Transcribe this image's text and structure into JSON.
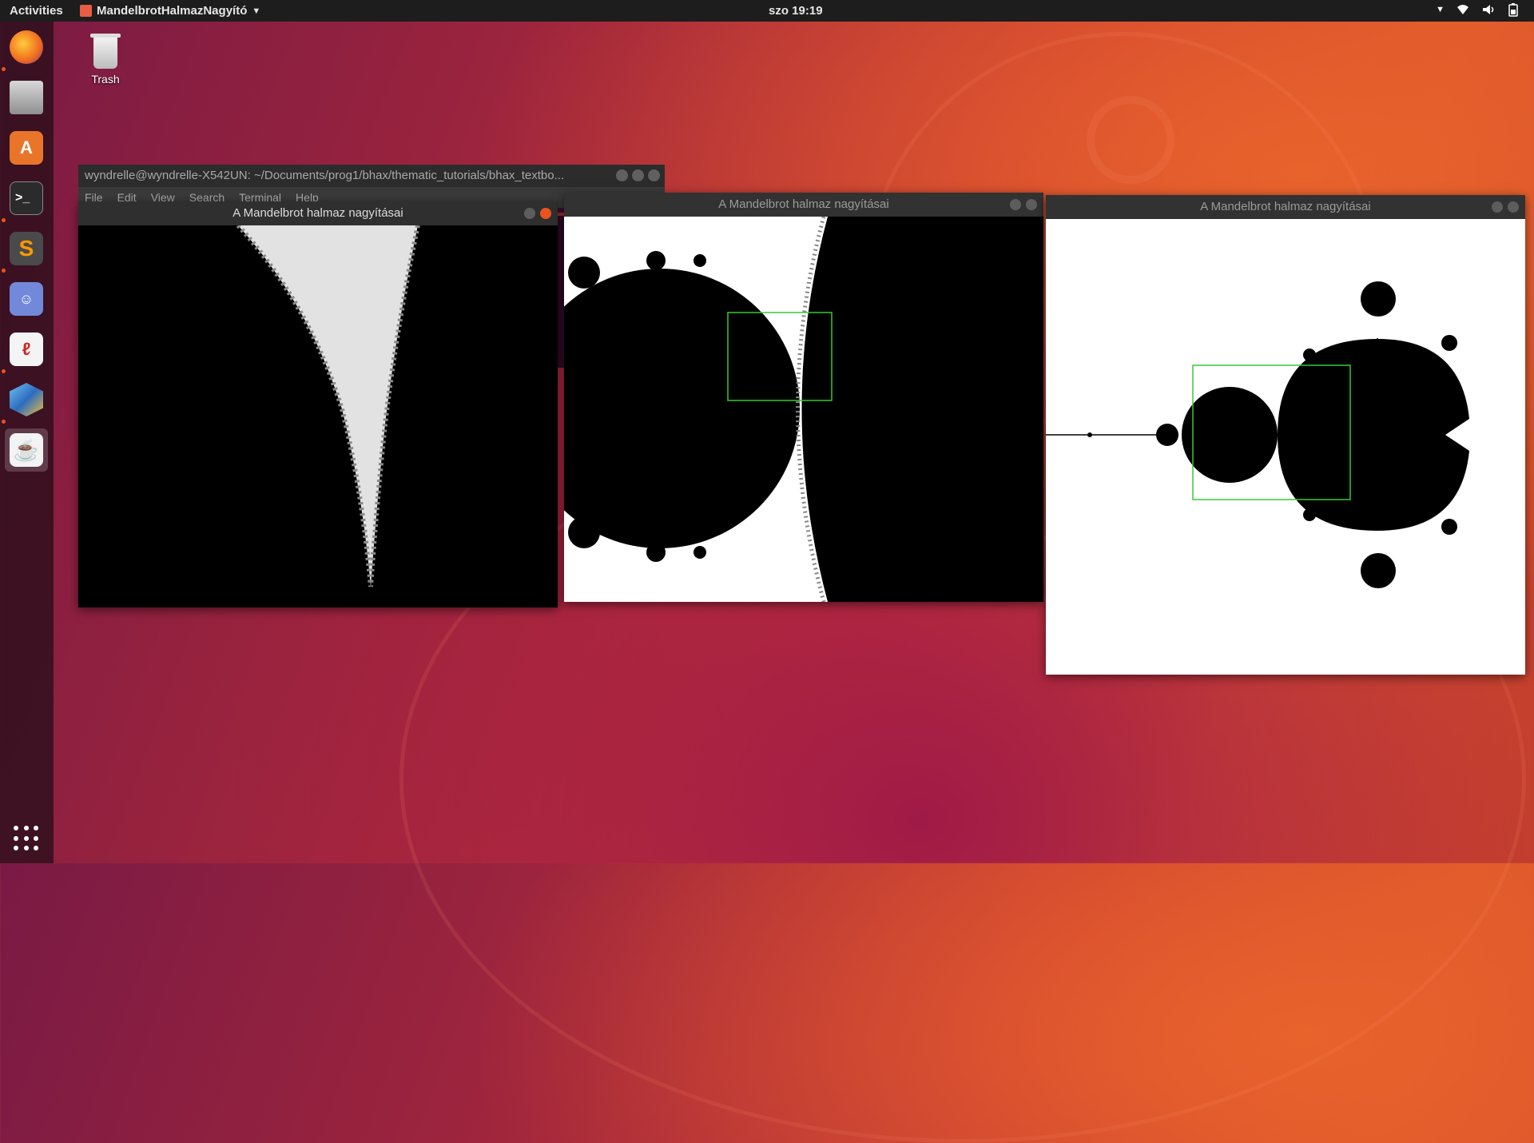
{
  "topbar": {
    "activities": "Activities",
    "app_name": "MandelbrotHalmazNagyító",
    "clock": "szo 19:19"
  },
  "desktop": {
    "trash_label": "Trash"
  },
  "dock": {
    "apps": [
      "firefox",
      "files",
      "software-center",
      "terminal",
      "sublime-text",
      "discord",
      "evince",
      "netbeans",
      "java"
    ]
  },
  "terminal": {
    "title": "wyndrelle@wyndrelle-X542UN: ~/Documents/prog1/bhax/thematic_tutorials/bhax_textbo...",
    "menu": [
      "File",
      "Edit",
      "View",
      "Search",
      "Terminal",
      "Help"
    ]
  },
  "windows": [
    {
      "title": "A Mandelbrot halmaz nagyításai"
    },
    {
      "title": "A Mandelbrot halmaz nagyításai"
    },
    {
      "title": "A Mandelbrot halmaz nagyításai"
    }
  ],
  "colors": {
    "ubuntu_orange": "#e95420",
    "selection_box": "#33cc33"
  }
}
